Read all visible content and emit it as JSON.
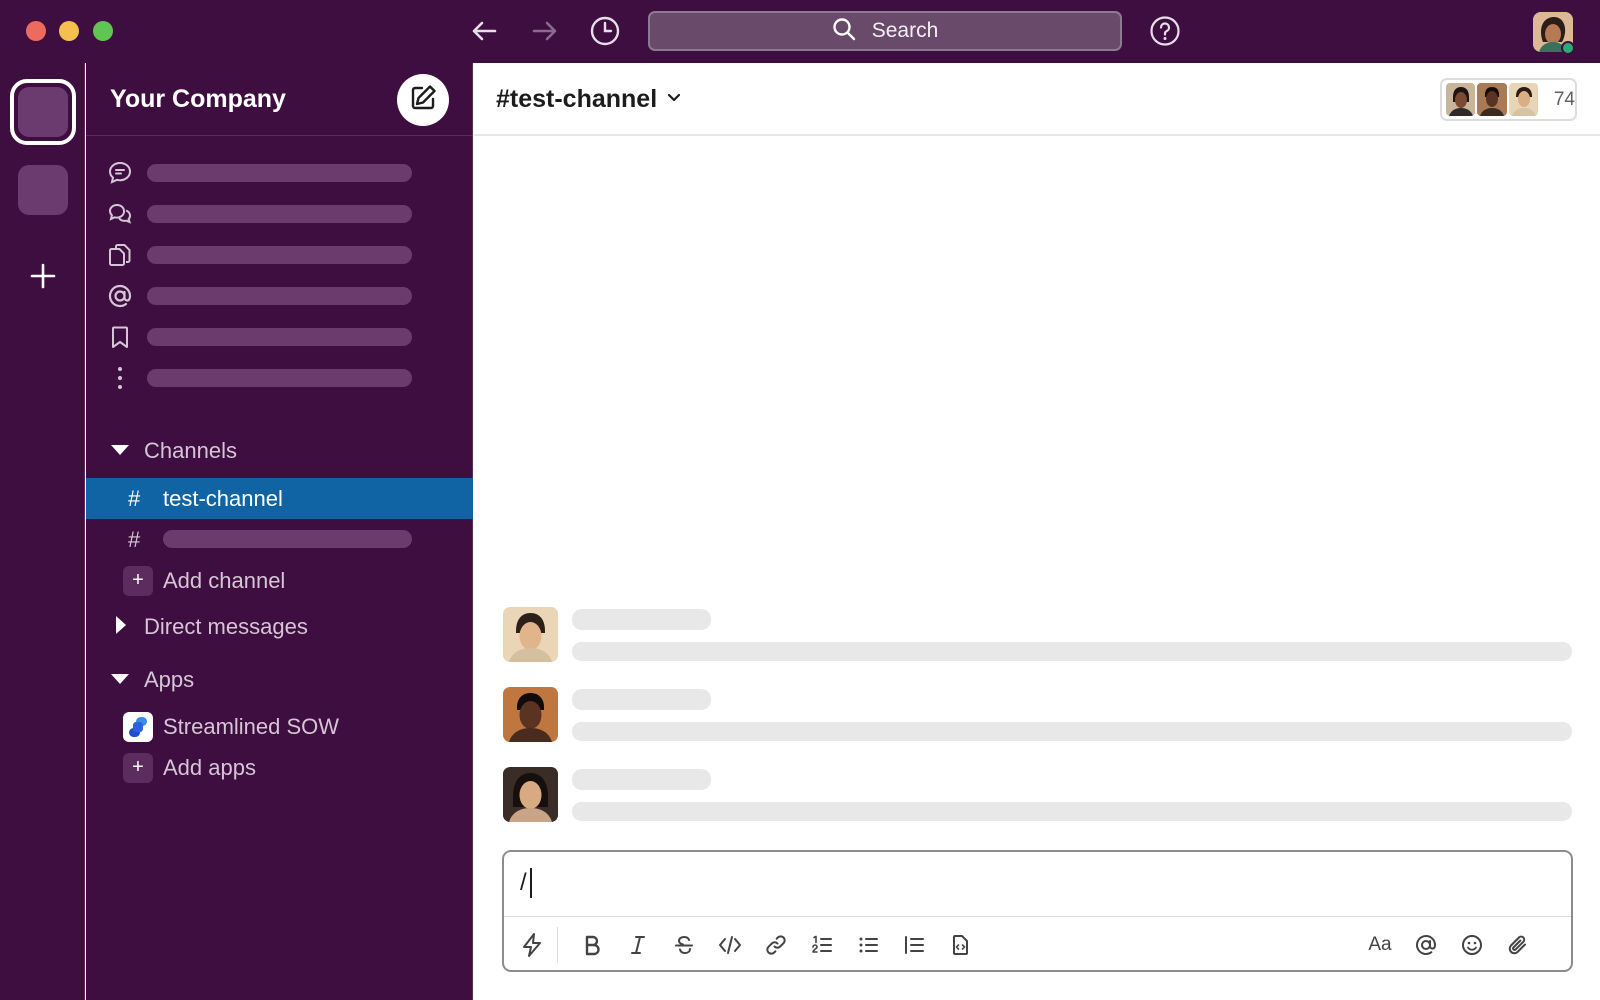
{
  "search": {
    "label": "Search"
  },
  "workspace": {
    "name": "Your Company"
  },
  "sidebar": {
    "nav_items": [
      {
        "icon": "threads-icon"
      },
      {
        "icon": "dms-icon"
      },
      {
        "icon": "files-icon"
      },
      {
        "icon": "mentions-icon"
      },
      {
        "icon": "saved-icon"
      },
      {
        "icon": "more-icon"
      }
    ],
    "channels_section": "Channels",
    "channels": [
      {
        "hash": "#",
        "name": "test-channel",
        "active": true
      },
      {
        "hash": "#",
        "name": ""
      }
    ],
    "add_channel": "Add channel",
    "dm_section": "Direct messages",
    "apps_section": "Apps",
    "apps": [
      {
        "name": "Streamlined SOW"
      }
    ],
    "add_apps": "Add apps",
    "plus_glyph": "+"
  },
  "channel": {
    "title": "#test-channel",
    "member_count": "74"
  },
  "composer": {
    "value": "/",
    "format_text_label": "Aa"
  },
  "colors": {
    "aubergine": "#3f0e40",
    "active_channel": "#1164a3",
    "presence": "#2bac76"
  }
}
